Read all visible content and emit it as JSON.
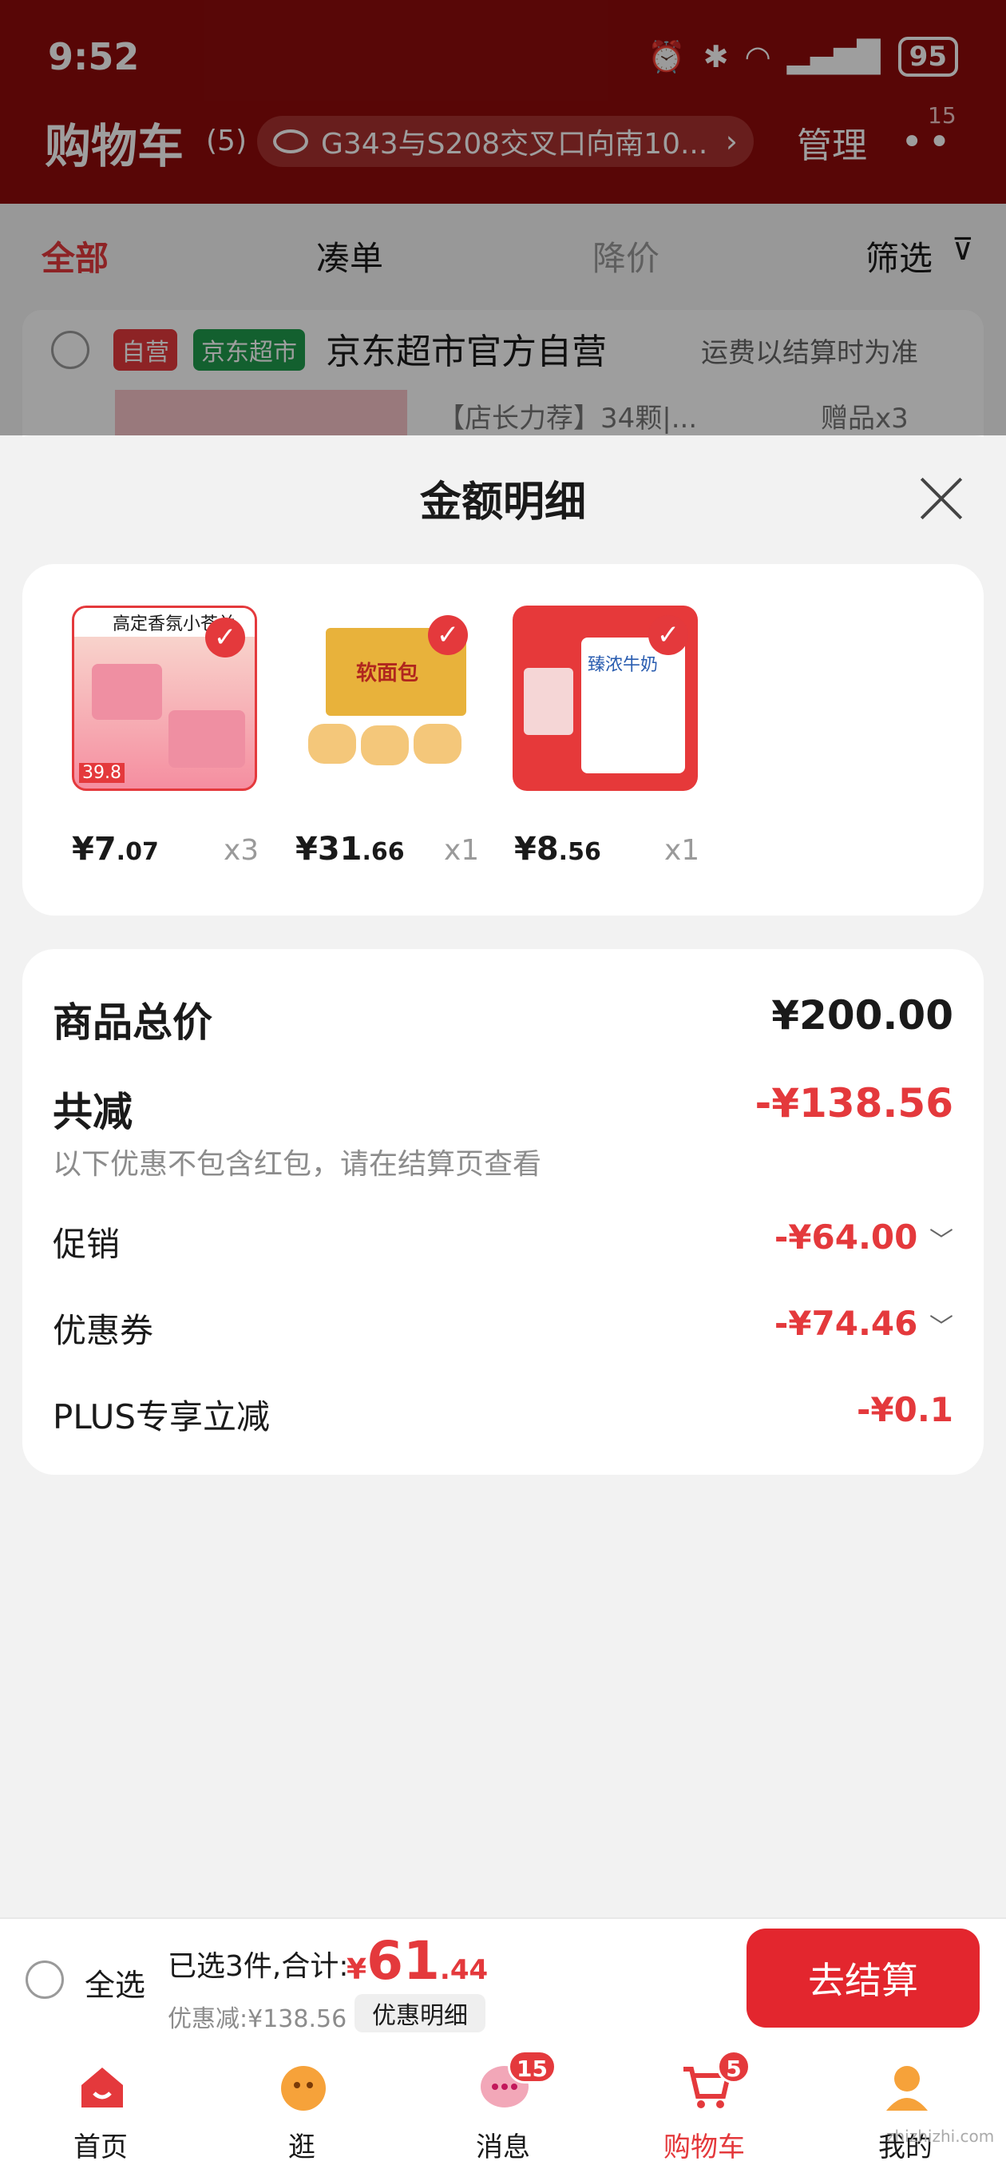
{
  "status_bar": {
    "time": "9:52",
    "battery": "95"
  },
  "header": {
    "title": "购物车",
    "count": "(5)",
    "address": "G343与S208交叉口向南10...",
    "manage": "管理",
    "more_badge": "15"
  },
  "tabs": {
    "all": "全部",
    "bundle": "凑单",
    "price_drop": "降价",
    "filter": "筛选"
  },
  "shop": {
    "tag_self": "自营",
    "tag_market": "京东超市",
    "name": "京东超市官方自营",
    "shipping_note": "运费以结算时为准",
    "spec": "【店长力荐】34颗|...",
    "gift": "赠品x3"
  },
  "sheet": {
    "title": "金额明细",
    "products": [
      {
        "price_int": "¥7",
        "price_dec": ".07",
        "qty": "x3",
        "img_badge": "39.8",
        "img_text": "高定香氛小苍兰"
      },
      {
        "price_int": "¥31",
        "price_dec": ".66",
        "qty": "x1",
        "img_text": "软面包"
      },
      {
        "price_int": "¥8",
        "price_dec": ".56",
        "qty": "x1",
        "img_text": "臻浓牛奶"
      }
    ],
    "summary": {
      "total_label": "商品总价",
      "total_value": "¥200.00",
      "discount_label": "共减",
      "discount_value": "-¥138.56",
      "discount_note": "以下优惠不包含红包，请在结算页查看",
      "promo_label": "促销",
      "promo_value": "-¥64.00",
      "coupon_label": "优惠券",
      "coupon_value": "-¥74.46",
      "plus_label": "PLUS专享立减",
      "plus_value": "-¥0.1"
    }
  },
  "checkout": {
    "select_all": "全选",
    "selected_text": "已选3件,合计:",
    "total_symbol": "¥",
    "total_int": "61",
    "total_dec": ".44",
    "saved_text": "优惠减:¥138.56",
    "detail_button": "优惠明细",
    "checkout_button": "去结算"
  },
  "tabbar": [
    {
      "label": "首页",
      "icon": "home-icon"
    },
    {
      "label": "逛",
      "icon": "browse-icon"
    },
    {
      "label": "消息",
      "icon": "message-icon",
      "badge": "15"
    },
    {
      "label": "购物车",
      "icon": "cart-icon",
      "badge": "5"
    },
    {
      "label": "我的",
      "icon": "profile-icon"
    }
  ],
  "watermark": "zhizhizhi.com",
  "colors": {
    "header_red": "#8e0b0b",
    "accent_red": "#e4393c",
    "market_green": "#1f9b4c"
  }
}
